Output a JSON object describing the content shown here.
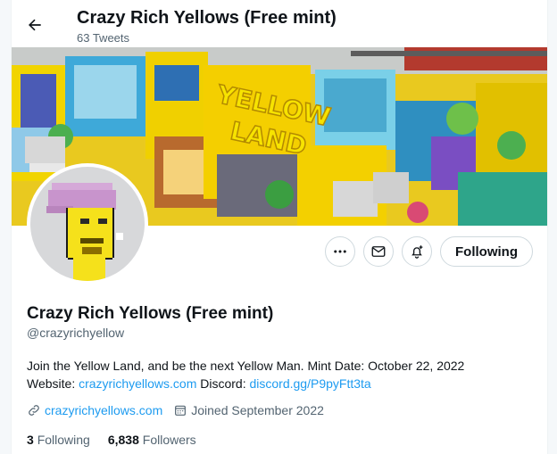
{
  "header": {
    "title": "Crazy Rich Yellows (Free mint)",
    "tweet_count": "63 Tweets"
  },
  "profile": {
    "display_name": "Crazy Rich Yellows (Free mint)",
    "handle": "@crazyrichyellow",
    "bio_text": "Join the Yellow Land, and be the next Yellow Man. Mint Date: October 22, 2022",
    "bio_website_label": "Website:",
    "bio_website_link": "crazyrichyellows.com",
    "bio_discord_label": "Discord:",
    "bio_discord_link": "discord.gg/P9pyFtt3ta",
    "url": "crazyrichyellows.com",
    "joined": "Joined September 2022",
    "following_count": "3",
    "following_label": "Following",
    "followers_count": "6,838",
    "followers_label": "Followers"
  },
  "banner": {
    "sign_text_1": "YELLOW",
    "sign_text_2": "LAND"
  },
  "actions": {
    "follow_button_label": "Following"
  },
  "icons": {
    "back": "arrow-left-icon",
    "more": "more-horizontal-icon",
    "message": "envelope-icon",
    "notify": "bell-plus-icon",
    "link": "link-icon",
    "calendar": "calendar-icon"
  },
  "colors": {
    "accent": "#1d9bf0",
    "text": "#0f1419",
    "secondary": "#536471"
  }
}
